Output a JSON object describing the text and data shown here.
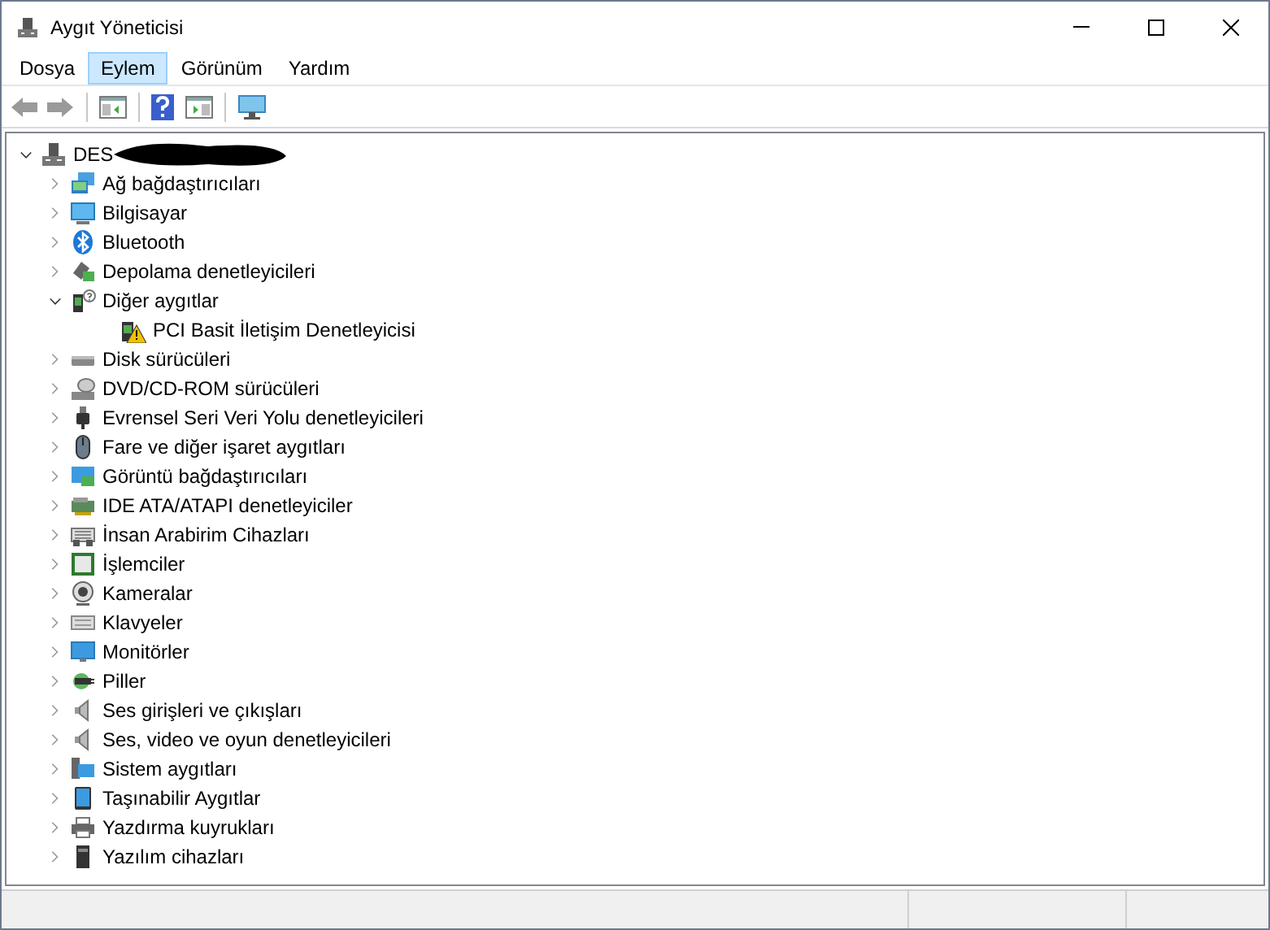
{
  "window": {
    "title": "Aygıt Yöneticisi"
  },
  "menu": [
    {
      "label": "Dosya",
      "selected": false
    },
    {
      "label": "Eylem",
      "selected": true
    },
    {
      "label": "Görünüm",
      "selected": false
    },
    {
      "label": "Yardım",
      "selected": false
    }
  ],
  "tree": {
    "root": {
      "label": "DES",
      "expanded": true,
      "redacted": true
    },
    "items": [
      {
        "label": "Ağ bağdaştırıcıları",
        "expanded": false
      },
      {
        "label": "Bilgisayar",
        "expanded": false
      },
      {
        "label": "Bluetooth",
        "expanded": false
      },
      {
        "label": "Depolama denetleyicileri",
        "expanded": false
      },
      {
        "label": "Diğer aygıtlar",
        "expanded": true,
        "children": [
          {
            "label": "PCI Basit İletişim Denetleyicisi",
            "warning": true
          }
        ]
      },
      {
        "label": "Disk sürücüleri",
        "expanded": false
      },
      {
        "label": "DVD/CD-ROM sürücüleri",
        "expanded": false
      },
      {
        "label": "Evrensel Seri Veri Yolu denetleyicileri",
        "expanded": false
      },
      {
        "label": "Fare ve diğer işaret aygıtları",
        "expanded": false
      },
      {
        "label": "Görüntü bağdaştırıcıları",
        "expanded": false
      },
      {
        "label": "IDE ATA/ATAPI denetleyiciler",
        "expanded": false
      },
      {
        "label": "İnsan Arabirim Cihazları",
        "expanded": false
      },
      {
        "label": "İşlemciler",
        "expanded": false
      },
      {
        "label": "Kameralar",
        "expanded": false
      },
      {
        "label": "Klavyeler",
        "expanded": false
      },
      {
        "label": "Monitörler",
        "expanded": false
      },
      {
        "label": "Piller",
        "expanded": false
      },
      {
        "label": "Ses girişleri ve çıkışları",
        "expanded": false
      },
      {
        "label": "Ses, video ve oyun denetleyicileri",
        "expanded": false
      },
      {
        "label": "Sistem aygıtları",
        "expanded": false
      },
      {
        "label": "Taşınabilir Aygıtlar",
        "expanded": false
      },
      {
        "label": "Yazdırma kuyrukları",
        "expanded": false
      },
      {
        "label": "Yazılım cihazları",
        "expanded": false
      }
    ]
  }
}
